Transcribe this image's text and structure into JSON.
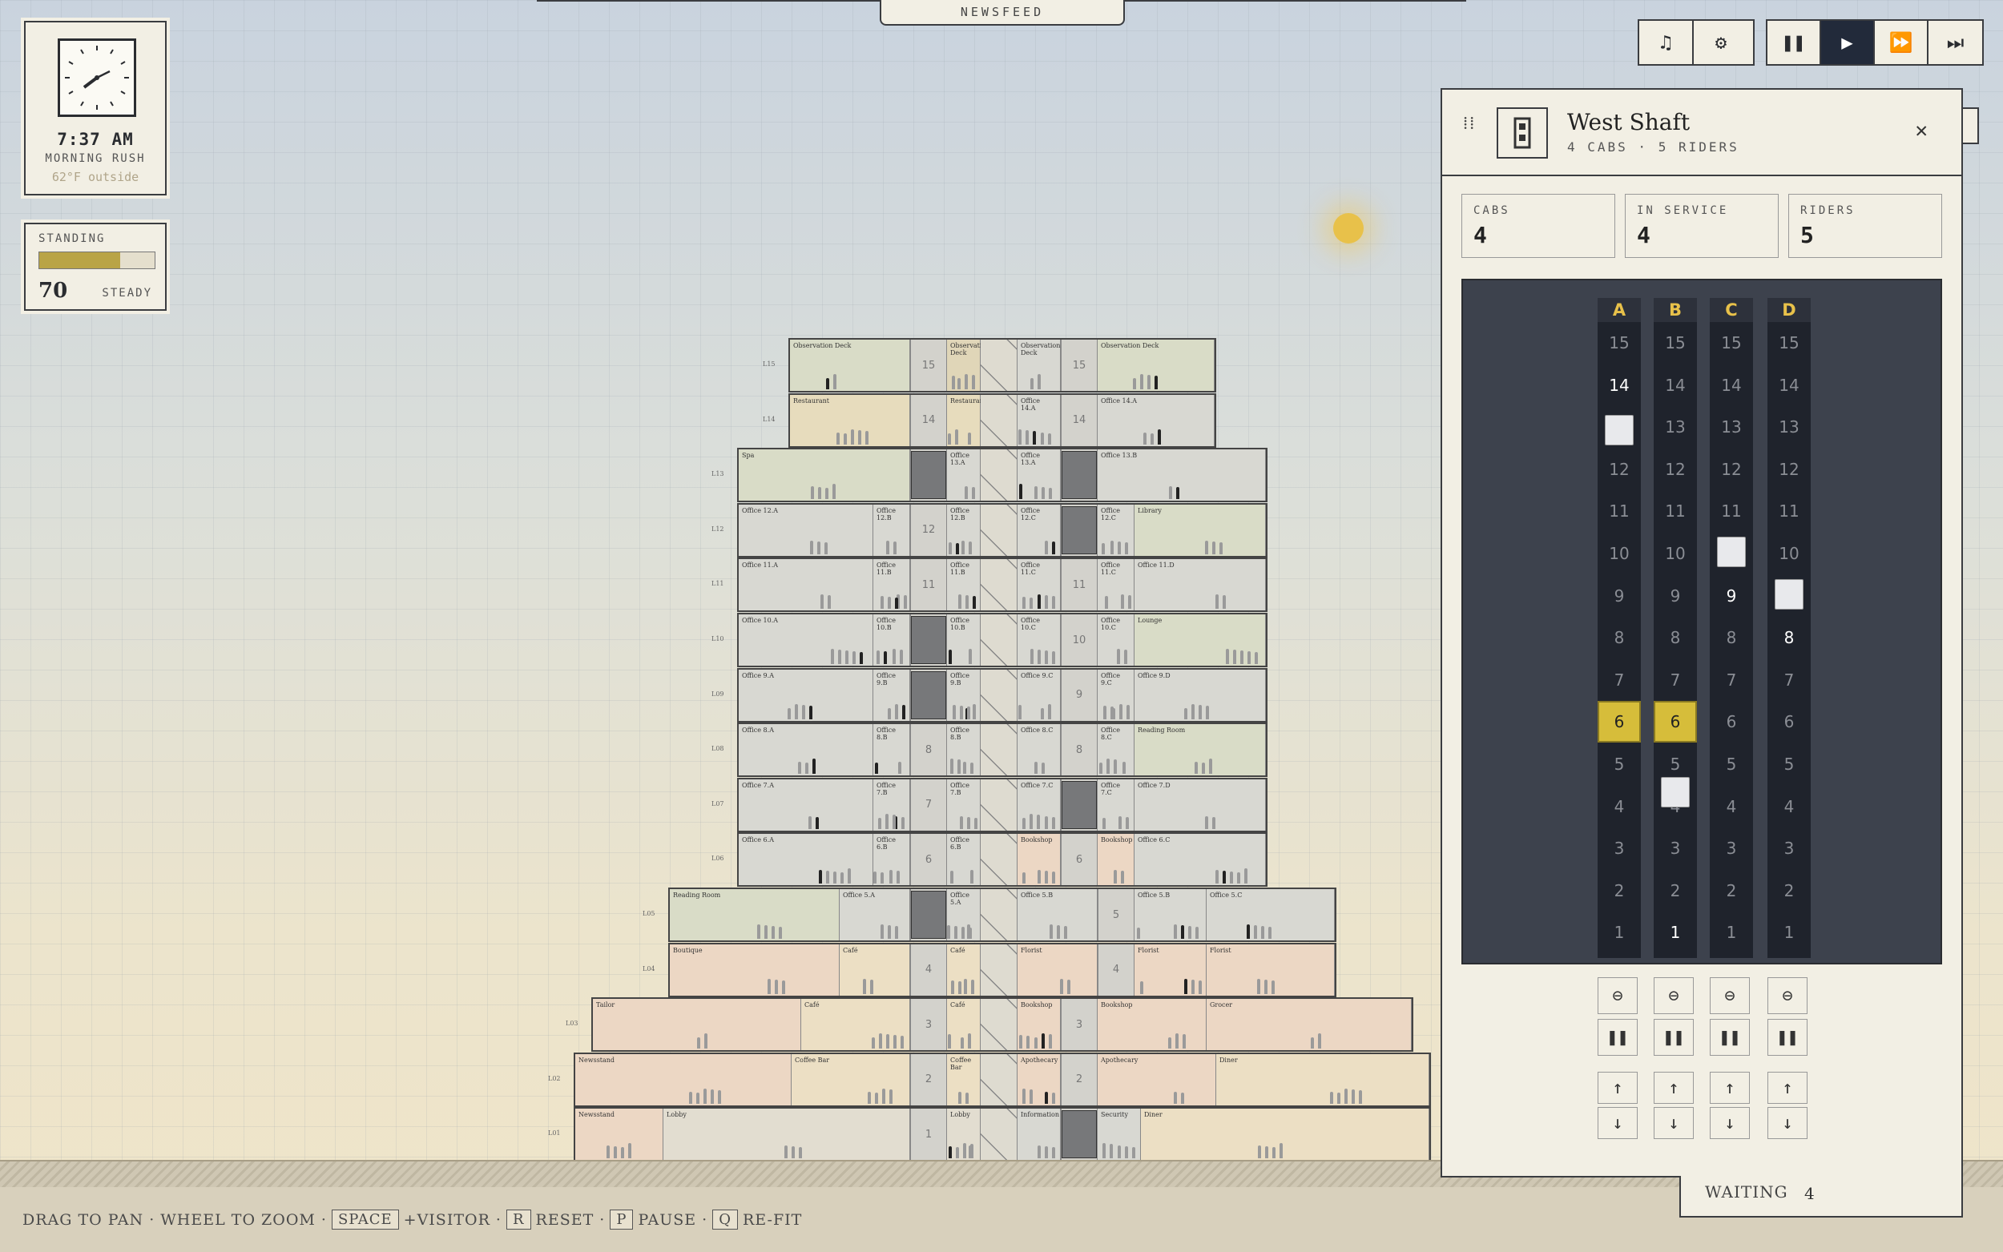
{
  "newsfeed": {
    "label": "NEWSFEED"
  },
  "clock": {
    "time": "7:37 AM",
    "phase": "MORNING RUSH",
    "temp": "62°F outside"
  },
  "standing": {
    "label": "STANDING",
    "value": "70",
    "level": 0.7,
    "trend": "STEADY"
  },
  "controls": {
    "music": "music-icon",
    "settings": "gear-icon",
    "pause": "pause-icon",
    "play": "play-icon",
    "fast": "fast-forward-icon",
    "fastest": "fastest-icon"
  },
  "shaft_panel": {
    "title": "West Shaft",
    "subtitle": "4 CABS · 5 RIDERS",
    "stats": [
      {
        "label": "CABS",
        "value": "4"
      },
      {
        "label": "IN SERVICE",
        "value": "4"
      },
      {
        "label": "RIDERS",
        "value": "5"
      }
    ],
    "columns": [
      "A",
      "B",
      "C",
      "D"
    ],
    "floors": [
      "15",
      "14",
      "13",
      "12",
      "11",
      "10",
      "9",
      "8",
      "7",
      "6",
      "5",
      "4",
      "3",
      "2",
      "1"
    ]
  },
  "waiting": {
    "label": "WAITING",
    "value": "4"
  },
  "hints": {
    "pan": "DRAG TO PAN · WHEEL TO ZOOM ·",
    "space_key": "SPACE",
    "space_text": "+VISITOR ·",
    "r_key": "R",
    "r_text": "RESET ·",
    "p_key": "P",
    "p_text": "PAUSE ·",
    "q_key": "Q",
    "q_text": "RE-FIT"
  },
  "tower": {
    "levels": [
      "L15",
      "L14",
      "L13",
      "L12",
      "L11",
      "L10",
      "L09",
      "L08",
      "L07",
      "L06",
      "L05",
      "L04",
      "L03",
      "L02",
      "L01"
    ],
    "floor_numbers": [
      "15",
      "14",
      "13",
      "12",
      "11",
      "10",
      "9",
      "8",
      "7",
      "6",
      "5",
      "4",
      "3",
      "2",
      "1"
    ],
    "rooms": [
      {
        "name": "Observation Deck"
      },
      {
        "name": "Observation Deck"
      },
      {
        "name": "Observation Deck"
      },
      {
        "name": "Observation Deck"
      },
      {
        "name": "Restaurant"
      },
      {
        "name": "Restaurant"
      },
      {
        "name": "Office 14.A"
      },
      {
        "name": "Office 14.A"
      },
      {
        "name": "Spa"
      },
      {
        "name": "Office 13.A"
      },
      {
        "name": "Office 13.A"
      },
      {
        "name": "Office 13.B"
      },
      {
        "name": "Office 12.A"
      },
      {
        "name": "Office 12.B"
      },
      {
        "name": "Office 12.B"
      },
      {
        "name": "Office 12.C"
      },
      {
        "name": "Office 12.C"
      },
      {
        "name": "Library"
      },
      {
        "name": "Office 11.A"
      },
      {
        "name": "Office 11.B"
      },
      {
        "name": "Office 11.B"
      },
      {
        "name": "Office 11.C"
      },
      {
        "name": "Office 11.C"
      },
      {
        "name": "Office 11.D"
      },
      {
        "name": "Office 10.A"
      },
      {
        "name": "Office 10.B"
      },
      {
        "name": "Office 10.B"
      },
      {
        "name": "Office 10.C"
      },
      {
        "name": "Office 10.C"
      },
      {
        "name": "Lounge"
      },
      {
        "name": "Office 9.A"
      },
      {
        "name": "Office 9.B"
      },
      {
        "name": "Office 9.B"
      },
      {
        "name": "Office 9.C"
      },
      {
        "name": "Office 9.C"
      },
      {
        "name": "Office 9.D"
      },
      {
        "name": "Office 8.A"
      },
      {
        "name": "Office 8.B"
      },
      {
        "name": "Office 8.B"
      },
      {
        "name": "Office 8.C"
      },
      {
        "name": "Office 8.C"
      },
      {
        "name": "Reading Room"
      },
      {
        "name": "Office 7.A"
      },
      {
        "name": "Office 7.B"
      },
      {
        "name": "Office 7.B"
      },
      {
        "name": "Office 7.C"
      },
      {
        "name": "Office 7.C"
      },
      {
        "name": "Office 7.D"
      },
      {
        "name": "Office 6.A"
      },
      {
        "name": "Office 6.B"
      },
      {
        "name": "Office 6.B"
      },
      {
        "name": "Bookshop"
      },
      {
        "name": "Bookshop"
      },
      {
        "name": "Office 6.C"
      },
      {
        "name": "Reading Room"
      },
      {
        "name": "Office 5.A"
      },
      {
        "name": "Office 5.A"
      },
      {
        "name": "Office 5.B"
      },
      {
        "name": "Office 5.B"
      },
      {
        "name": "Office 5.C"
      },
      {
        "name": "Boutique"
      },
      {
        "name": "Café"
      },
      {
        "name": "Café"
      },
      {
        "name": "Florist"
      },
      {
        "name": "Florist"
      },
      {
        "name": "Florist"
      },
      {
        "name": "Tailor"
      },
      {
        "name": "Café"
      },
      {
        "name": "Café"
      },
      {
        "name": "Bookshop"
      },
      {
        "name": "Bookshop"
      },
      {
        "name": "Grocer"
      },
      {
        "name": "Newsstand"
      },
      {
        "name": "Coffee Bar"
      },
      {
        "name": "Coffee Bar"
      },
      {
        "name": "Apothecary"
      },
      {
        "name": "Apothecary"
      },
      {
        "name": "Diner"
      },
      {
        "name": "Newsstand"
      },
      {
        "name": "Lobby"
      },
      {
        "name": "Lobby"
      },
      {
        "name": "Information"
      },
      {
        "name": "Security"
      },
      {
        "name": "Diner"
      }
    ]
  },
  "colors": {
    "accent": "#d6bd3a",
    "board": "#3d424d",
    "panel": "#f2efe4"
  }
}
